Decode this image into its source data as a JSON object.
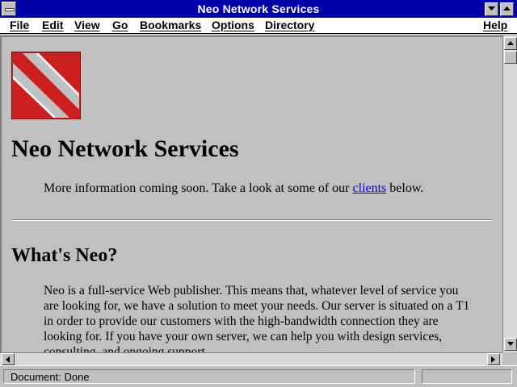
{
  "window": {
    "title": "Neo Network Services"
  },
  "menu": {
    "file": "File",
    "edit": "Edit",
    "view": "View",
    "go": "Go",
    "bookmarks": "Bookmarks",
    "options": "Options",
    "directory": "Directory",
    "help": "Help"
  },
  "page": {
    "heading": "Neo Network Services",
    "intro_before": "More information coming soon. Take a look at some of our ",
    "intro_link": "clients",
    "intro_after": " below.",
    "section_heading": "What's Neo?",
    "body": "Neo is a full-service Web publisher. This means that, whatever level of service you are looking for, we have a solution to meet your needs. Our server is situated on a T1 in order to provide our customers with the high-bandwidth connection they are looking for. If you have your own server, we can help you with design services, consulting, and ongoing support."
  },
  "status": {
    "text": "Document: Done"
  },
  "icons": {
    "logo": "neo-logo",
    "system_menu": "system-menu-icon",
    "minimize": "minimize-icon",
    "maximize": "maximize-icon",
    "scroll_up": "arrow-up-icon",
    "scroll_down": "arrow-down-icon",
    "scroll_left": "arrow-left-icon",
    "scroll_right": "arrow-right-icon"
  },
  "colors": {
    "title_bar": "#0000a8",
    "background": "#c0c0c0",
    "link": "#0000ff",
    "logo_red": "#cc2020"
  }
}
